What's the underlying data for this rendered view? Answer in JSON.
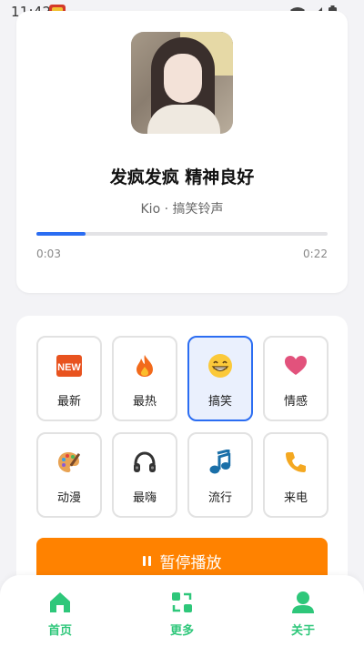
{
  "status_bar": {
    "time": "11:42"
  },
  "player": {
    "title": "发疯发疯 精神良好",
    "artist": "Kio · 搞笑铃声",
    "current_time": "0:03",
    "total_time": "0:22",
    "progress_fraction": 0.17,
    "accent_color": "#2b6df2"
  },
  "categories": [
    {
      "label": "最新",
      "icon": "new-badge-icon",
      "active": false
    },
    {
      "label": "最热",
      "icon": "fire-icon",
      "active": false
    },
    {
      "label": "搞笑",
      "icon": "grinning-face-icon",
      "active": true
    },
    {
      "label": "情感",
      "icon": "heart-icon",
      "active": false
    },
    {
      "label": "动漫",
      "icon": "palette-icon",
      "active": false
    },
    {
      "label": "最嗨",
      "icon": "headphones-icon",
      "active": false
    },
    {
      "label": "流行",
      "icon": "music-note-icon",
      "active": false
    },
    {
      "label": "来电",
      "icon": "phone-icon",
      "active": false
    }
  ],
  "pause_button": {
    "label": "暂停播放",
    "color": "#ff8200"
  },
  "tabs": [
    {
      "label": "首页",
      "icon": "home-icon"
    },
    {
      "label": "更多",
      "icon": "refresh-icon"
    },
    {
      "label": "关于",
      "icon": "user-icon"
    }
  ],
  "tab_color": "#2ec77a"
}
